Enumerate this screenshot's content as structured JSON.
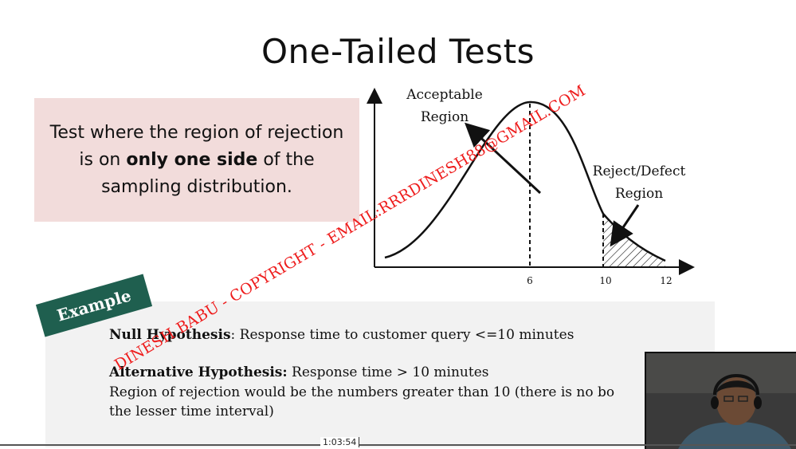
{
  "slide": {
    "title": "One-Tailed Tests",
    "definition": {
      "before": "Test where the region of rejection is on ",
      "bold": "only one side",
      "after": " of the sampling distribution."
    },
    "figure": {
      "acceptable_label_line1": "Acceptable",
      "acceptable_label_line2": "Region",
      "reject_label_line1": "Reject/Defect",
      "reject_label_line2": "Region",
      "tick_labels": [
        "6",
        "10",
        "12"
      ]
    },
    "example": {
      "badge": "Example",
      "null_label": "Null Hypothesis",
      "null_text": ":  Response time to customer query <=10 minutes",
      "alt_label": "Alternative Hypothesis:",
      "alt_text": " Response time > 10 minutes",
      "region_line1": "Region of rejection would be the numbers greater than 10 (there is no bo",
      "region_line2": "the lesser time interval)"
    },
    "watermark": "DINESH BABU - COPYRIGHT - EMAIL:RRRDINESH88@GMAIL.COM"
  },
  "player": {
    "timestamp": "1:03:54"
  },
  "colors": {
    "definition_bg": "#f2dcdb",
    "badge_bg": "#1f5f4f",
    "watermark": "#ee1c1c",
    "example_bg": "#f2f2f2"
  }
}
